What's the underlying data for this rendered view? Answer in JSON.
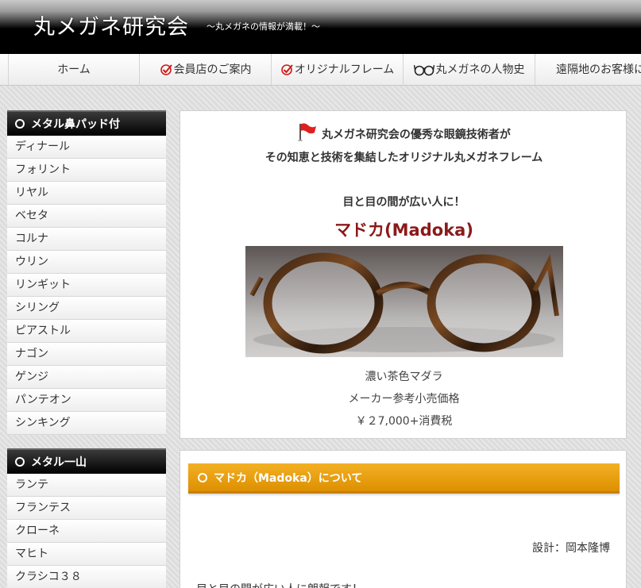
{
  "header": {
    "title": "丸メガネ研究会",
    "tagline": "～丸メガネの情報が満載！～"
  },
  "nav": {
    "items": [
      {
        "label": "ホーム",
        "icon": ""
      },
      {
        "label": "会員店のご案内",
        "icon": "check-icon"
      },
      {
        "label": "オリジナルフレーム",
        "icon": "check-icon"
      },
      {
        "label": "丸メガネの人物史",
        "icon": "glasses-icon"
      },
      {
        "label": "遠隔地のお客様に",
        "icon": ""
      }
    ]
  },
  "sidebar": {
    "boxes": [
      {
        "heading": "メタル鼻パッド付",
        "items": [
          "ディナール",
          "フォリント",
          "リヤル",
          "ベセタ",
          "コルナ",
          "ウリン",
          "リンギット",
          "シリング",
          "ピアストル",
          "ナゴン",
          "ゲンジ",
          "パンテオン",
          "シンキング"
        ]
      },
      {
        "heading": "メタル一山",
        "items": [
          "ランテ",
          "フランテス",
          "クローネ",
          "マヒト",
          "クラシコ３８"
        ]
      }
    ]
  },
  "product": {
    "intro_line1": "丸メガネ研究会の優秀な眼鏡技術者が",
    "intro_line2": "その知恵と技術を集結したオリジナル丸メガネフレーム",
    "catch": "目と目の間が広い人に！",
    "name": "マドカ(Madoka)",
    "color": "濃い茶色マダラ",
    "price_label": "メーカー参考小売価格",
    "price": "￥２7,000+消費税"
  },
  "about": {
    "heading": "マドカ（Madoka）について",
    "designer": "設計：岡本隆博",
    "text": "目と目の間が広い人に朗報です！"
  },
  "colors": {
    "accent_orange": "#e89a08",
    "title_red": "#8b1a1a",
    "check_red": "#d11a1a"
  }
}
